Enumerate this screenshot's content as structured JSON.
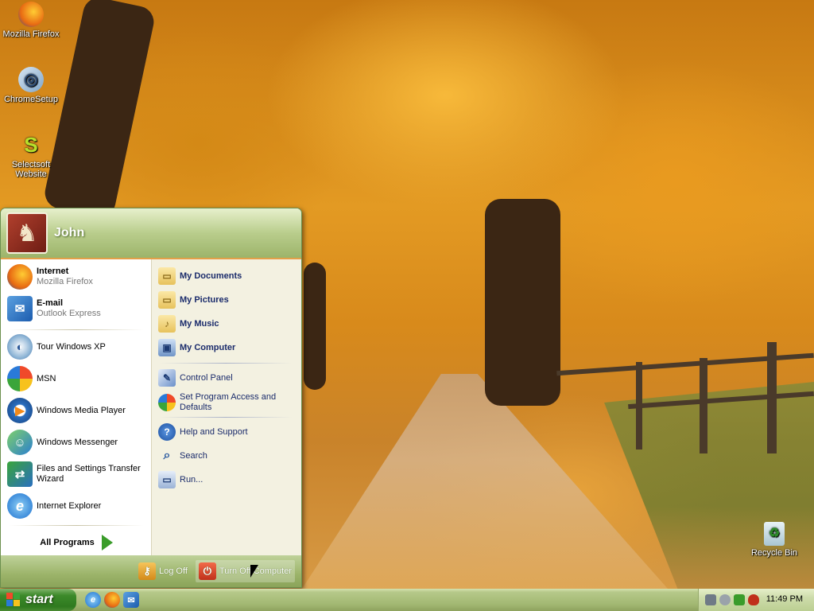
{
  "desktop": {
    "icons": [
      {
        "label": "Mozilla Firefox",
        "icon": "firefox-icon"
      },
      {
        "label": "ChromeSetup",
        "icon": "chrome-setup-icon"
      },
      {
        "label": "Selectsoft Website",
        "icon": "selectsoft-icon"
      },
      {
        "label": "Recycle Bin",
        "icon": "recycle-bin-icon"
      }
    ]
  },
  "start_menu": {
    "user_name": "John",
    "left_pinned": [
      {
        "title": "Internet",
        "subtitle": "Mozilla Firefox",
        "icon": "firefox-icon"
      },
      {
        "title": "E-mail",
        "subtitle": "Outlook Express",
        "icon": "outlook-express-icon"
      }
    ],
    "left_recent": [
      {
        "label": "Tour Windows XP",
        "icon": "tour-windows-xp-icon"
      },
      {
        "label": "MSN",
        "icon": "msn-butterfly-icon"
      },
      {
        "label": "Windows Media Player",
        "icon": "media-player-icon"
      },
      {
        "label": "Windows Messenger",
        "icon": "messenger-icon"
      },
      {
        "label": "Files and Settings Transfer Wizard",
        "icon": "transfer-wizard-icon"
      },
      {
        "label": "Internet Explorer",
        "icon": "internet-explorer-icon"
      }
    ],
    "all_programs": "All Programs",
    "right_items": [
      {
        "label": "My Documents",
        "icon": "folder-icon"
      },
      {
        "label": "My Pictures",
        "icon": "folder-icon"
      },
      {
        "label": "My Music",
        "icon": "folder-icon"
      },
      {
        "label": "My Computer",
        "icon": "computer-icon"
      },
      {
        "label": "Control Panel",
        "icon": "control-panel-icon"
      },
      {
        "label": "Set Program Access and Defaults",
        "icon": "program-access-icon"
      },
      {
        "label": "Help and Support",
        "icon": "help-icon"
      },
      {
        "label": "Search",
        "icon": "search-icon"
      },
      {
        "label": "Run...",
        "icon": "run-icon"
      }
    ],
    "log_off": "Log Off",
    "turn_off": "Turn Off Computer"
  },
  "taskbar": {
    "start_label": "start",
    "quick_launch": [
      "internet-explorer-icon",
      "firefox-icon",
      "outlook-express-icon"
    ],
    "tray_icons": [
      "network-icon",
      "volume-icon",
      "safely-remove-icon",
      "security-shield-icon"
    ],
    "clock": "11:49 PM"
  },
  "colors": {
    "accent_orange": "#e3a049",
    "menu_header_green": "#9cb46a",
    "start_button_green": "#3c8a2a"
  }
}
